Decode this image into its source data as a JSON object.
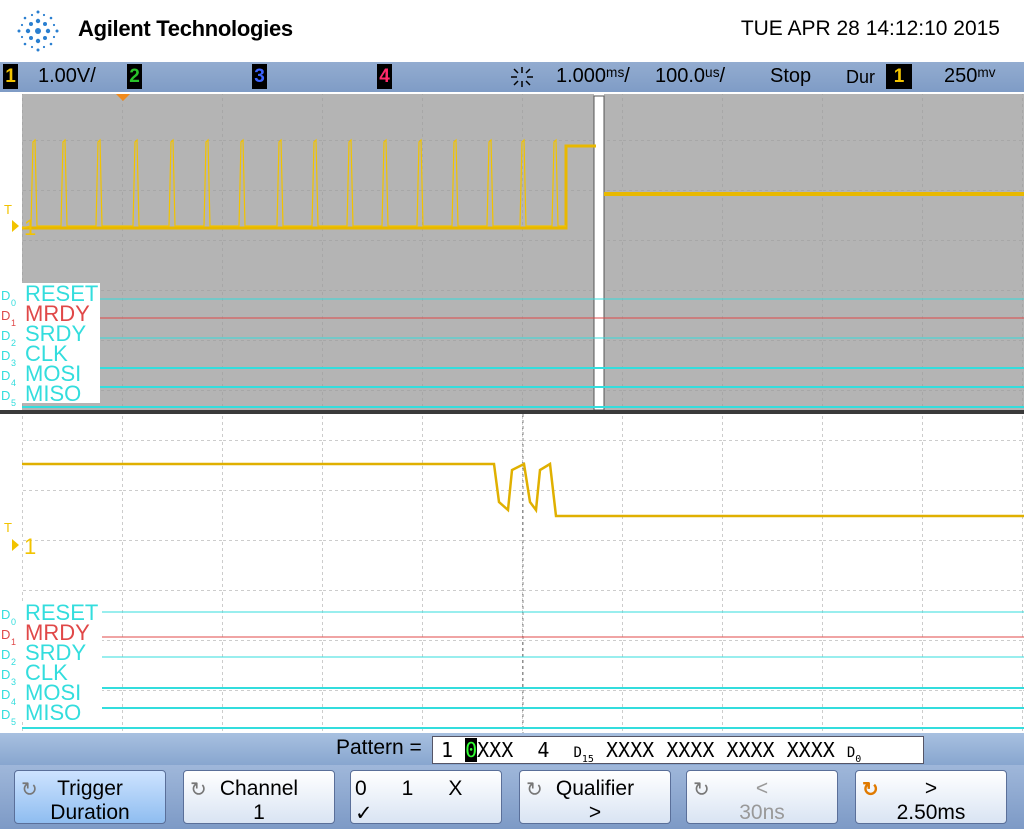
{
  "header": {
    "brand": "Agilent Technologies",
    "datetime": "TUE APR 28 14:12:10 2015"
  },
  "statusbar": {
    "ch1_num": "1",
    "ch1_scale": "1.00V/",
    "ch2_num": "2",
    "ch3_num": "3",
    "ch4_num": "4",
    "time_ref": "1.000ᵐˢ/",
    "time_scale": "100.0ᵘˢ/",
    "run_state": "Stop",
    "trigger_type": "Dur",
    "trigger_source": "1",
    "trigger_level": "250ᵐᵛ",
    "colors": {
      "ch1": "#f2c300",
      "ch2": "#29c229",
      "ch3": "#3c64ff",
      "ch4": "#ff2a6a"
    }
  },
  "scope": {
    "ch1_marker": "1",
    "trig_marker": "T",
    "digital_channels": [
      {
        "id": "D",
        "sub": "0",
        "name": "RESET",
        "color": "#33dddd"
      },
      {
        "id": "D",
        "sub": "1",
        "name": "MRDY",
        "color": "#e04848"
      },
      {
        "id": "D",
        "sub": "2",
        "name": "SRDY",
        "color": "#33dddd"
      },
      {
        "id": "D",
        "sub": "3",
        "name": "CLK",
        "color": "#33dddd"
      },
      {
        "id": "D",
        "sub": "4",
        "name": "MOSI",
        "color": "#33dddd"
      },
      {
        "id": "D",
        "sub": "5",
        "name": "MISO",
        "color": "#33dddd"
      }
    ]
  },
  "pattern": {
    "label": "Pattern =",
    "prefix": "1 ",
    "selected": "0",
    "rest": "XXX  4  ",
    "d15": "D",
    "d15_sub": "15",
    "bits": " XXXX XXXX XXXX XXXX ",
    "d0": "D",
    "d0_sub": "0"
  },
  "softkeys": [
    {
      "line1": "Trigger",
      "line2": "Duration"
    },
    {
      "line1": "Channel",
      "line2": "1"
    },
    {
      "line1": "0      1      X",
      "line2": "✓"
    },
    {
      "line1": "Qualifier",
      "line2": ">"
    },
    {
      "line1": "<",
      "line2": "30ns"
    },
    {
      "line1": ">",
      "line2": "2.50ms"
    }
  ]
}
